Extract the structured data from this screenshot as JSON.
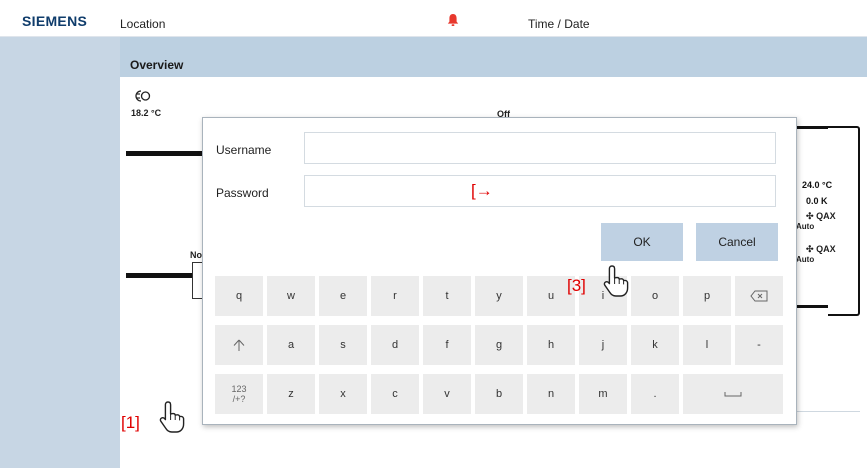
{
  "header": {
    "brand": "SIEMENS",
    "location_label": "Location",
    "time_date_label": "Time / Date",
    "alarm_icon": "bell-icon",
    "alarm_color": "#e8382d"
  },
  "overview": {
    "title": "Overview",
    "sensor_icon": "room-sensor-icon",
    "temperature_left": "18.2 °C",
    "status_off": "Off",
    "label_no": "No",
    "right_panel": {
      "temperature": "24.0 °C",
      "delta": "0.0 K",
      "qax_1": "QAX",
      "auto_1": "Auto",
      "qax_2": "QAX",
      "auto_2": "Auto"
    }
  },
  "login": {
    "username_label": "Username",
    "username_value": "",
    "password_label": "Password",
    "password_value": "",
    "ok_label": "OK",
    "cancel_label": "Cancel"
  },
  "keyboard": {
    "row1": [
      "q",
      "w",
      "e",
      "r",
      "t",
      "y",
      "u",
      "i",
      "o",
      "p"
    ],
    "row2": [
      "a",
      "s",
      "d",
      "f",
      "g",
      "h",
      "j",
      "k",
      "l",
      "-"
    ],
    "row3": [
      "z",
      "x",
      "c",
      "v",
      "b",
      "n",
      "m",
      "."
    ],
    "mode_key": "123\n/+?",
    "backspace_icon": "backspace-icon",
    "shift_icon": "shift-icon",
    "space_icon": "space-icon"
  },
  "annotations": {
    "step1": "[1]",
    "step2": "[→",
    "step3": "[3]",
    "color": "#e00000"
  }
}
